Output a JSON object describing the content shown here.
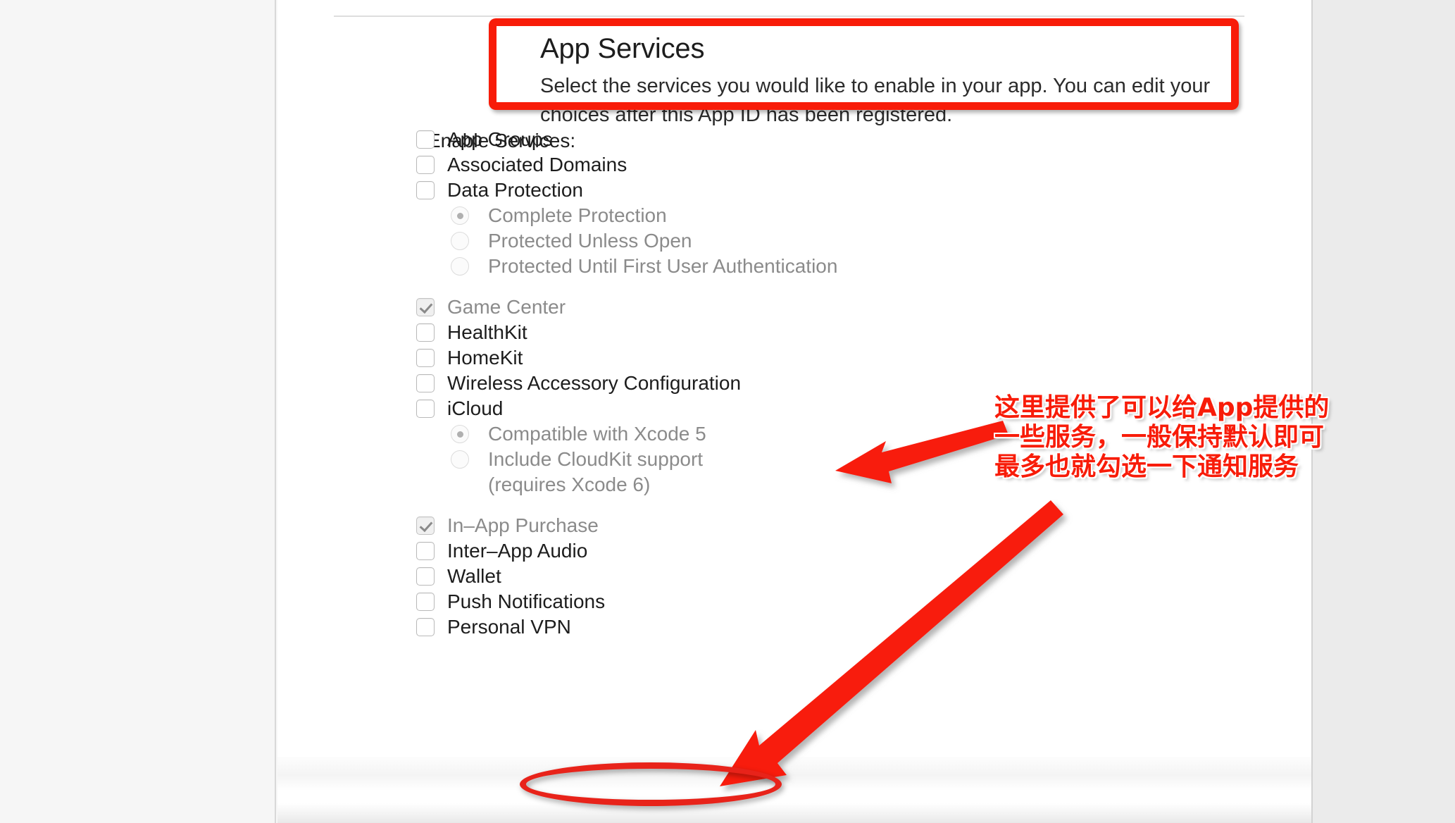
{
  "header": {
    "title": "App Services",
    "description": "Select the services you would like to enable in your app. You can edit your choices after this App ID has been registered."
  },
  "form": {
    "row_label": "Enable Services:",
    "groups": [
      {
        "items": [
          {
            "type": "checkbox",
            "label": "App Groups",
            "checked": false,
            "enabled": true
          },
          {
            "type": "checkbox",
            "label": "Associated Domains",
            "checked": false,
            "enabled": true
          },
          {
            "type": "checkbox",
            "label": "Data Protection",
            "checked": false,
            "enabled": true
          },
          {
            "type": "radio",
            "label": "Complete Protection",
            "selected": true,
            "enabled": false
          },
          {
            "type": "radio",
            "label": "Protected Unless Open",
            "selected": false,
            "enabled": false
          },
          {
            "type": "radio",
            "label": "Protected Until First User Authentication",
            "selected": false,
            "enabled": false
          }
        ]
      },
      {
        "items": [
          {
            "type": "checkbox",
            "label": "Game Center",
            "checked": true,
            "enabled": false
          },
          {
            "type": "checkbox",
            "label": "HealthKit",
            "checked": false,
            "enabled": true
          },
          {
            "type": "checkbox",
            "label": "HomeKit",
            "checked": false,
            "enabled": true
          },
          {
            "type": "checkbox",
            "label": "Wireless Accessory Configuration",
            "checked": false,
            "enabled": true
          },
          {
            "type": "checkbox",
            "label": "iCloud",
            "checked": false,
            "enabled": true
          },
          {
            "type": "radio",
            "label": "Compatible with Xcode 5",
            "selected": true,
            "enabled": false
          },
          {
            "type": "radio",
            "label": "Include CloudKit support",
            "selected": false,
            "enabled": false
          },
          {
            "type": "continuation",
            "label": "(requires Xcode 6)"
          }
        ]
      },
      {
        "items": [
          {
            "type": "checkbox",
            "label": "In–App Purchase",
            "checked": true,
            "enabled": false
          },
          {
            "type": "checkbox",
            "label": "Inter–App Audio",
            "checked": false,
            "enabled": true
          },
          {
            "type": "checkbox",
            "label": "Wallet",
            "checked": false,
            "enabled": true
          },
          {
            "type": "checkbox",
            "label": "Push Notifications",
            "checked": false,
            "enabled": true
          },
          {
            "type": "checkbox",
            "label": "Personal VPN",
            "checked": false,
            "enabled": true
          }
        ]
      }
    ]
  },
  "annotations": {
    "accent_color": "#f81c09",
    "note_lines": [
      "这里提供了可以给App提供的",
      "一些服务，一般保持默认即可",
      "最多也就勾选一下通知服务"
    ],
    "highlight_box_target": "App Services",
    "circle_target": "Push Notifications"
  }
}
